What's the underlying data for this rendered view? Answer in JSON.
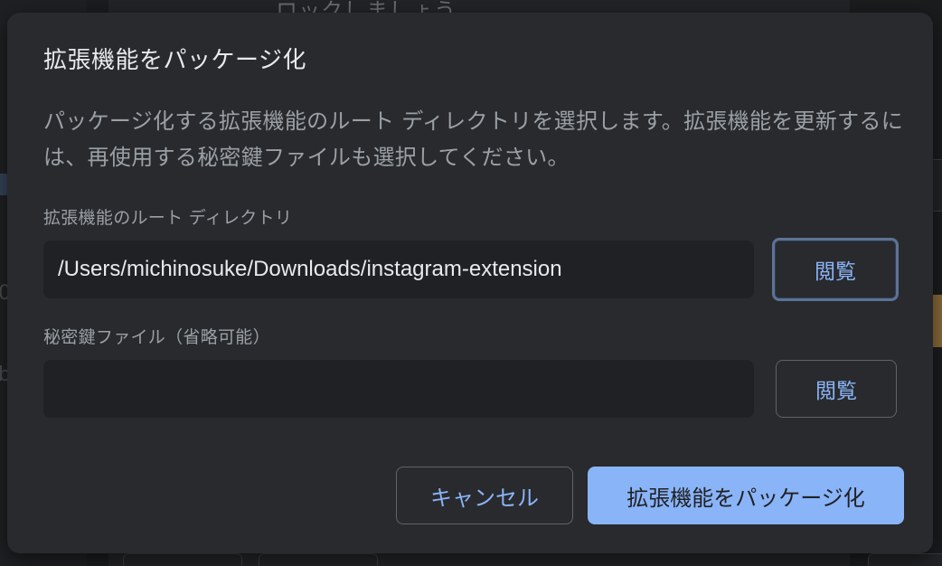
{
  "background": {
    "partial_heading": "ロックしましょう"
  },
  "dialog": {
    "title": "拡張機能をパッケージ化",
    "description": "パッケージ化する拡張機能のルート ディレクトリを選択します。拡張機能を更新するには、再使用する秘密鍵ファイルも選択してください。",
    "root_dir": {
      "label": "拡張機能のルート ディレクトリ",
      "value": "/Users/michinosuke/Downloads/instagram-extension",
      "browse_label": "閲覧"
    },
    "private_key": {
      "label": "秘密鍵ファイル（省略可能）",
      "value": "",
      "browse_label": "閲覧"
    },
    "cancel_label": "キャンセル",
    "submit_label": "拡張機能をパッケージ化"
  },
  "colors": {
    "dialog_bg": "#292a2d",
    "field_bg": "#202124",
    "accent": "#8ab4f8",
    "title_text": "#e8eaed",
    "muted_text": "#9aa0a6",
    "focus_ring": "#5d7394"
  }
}
